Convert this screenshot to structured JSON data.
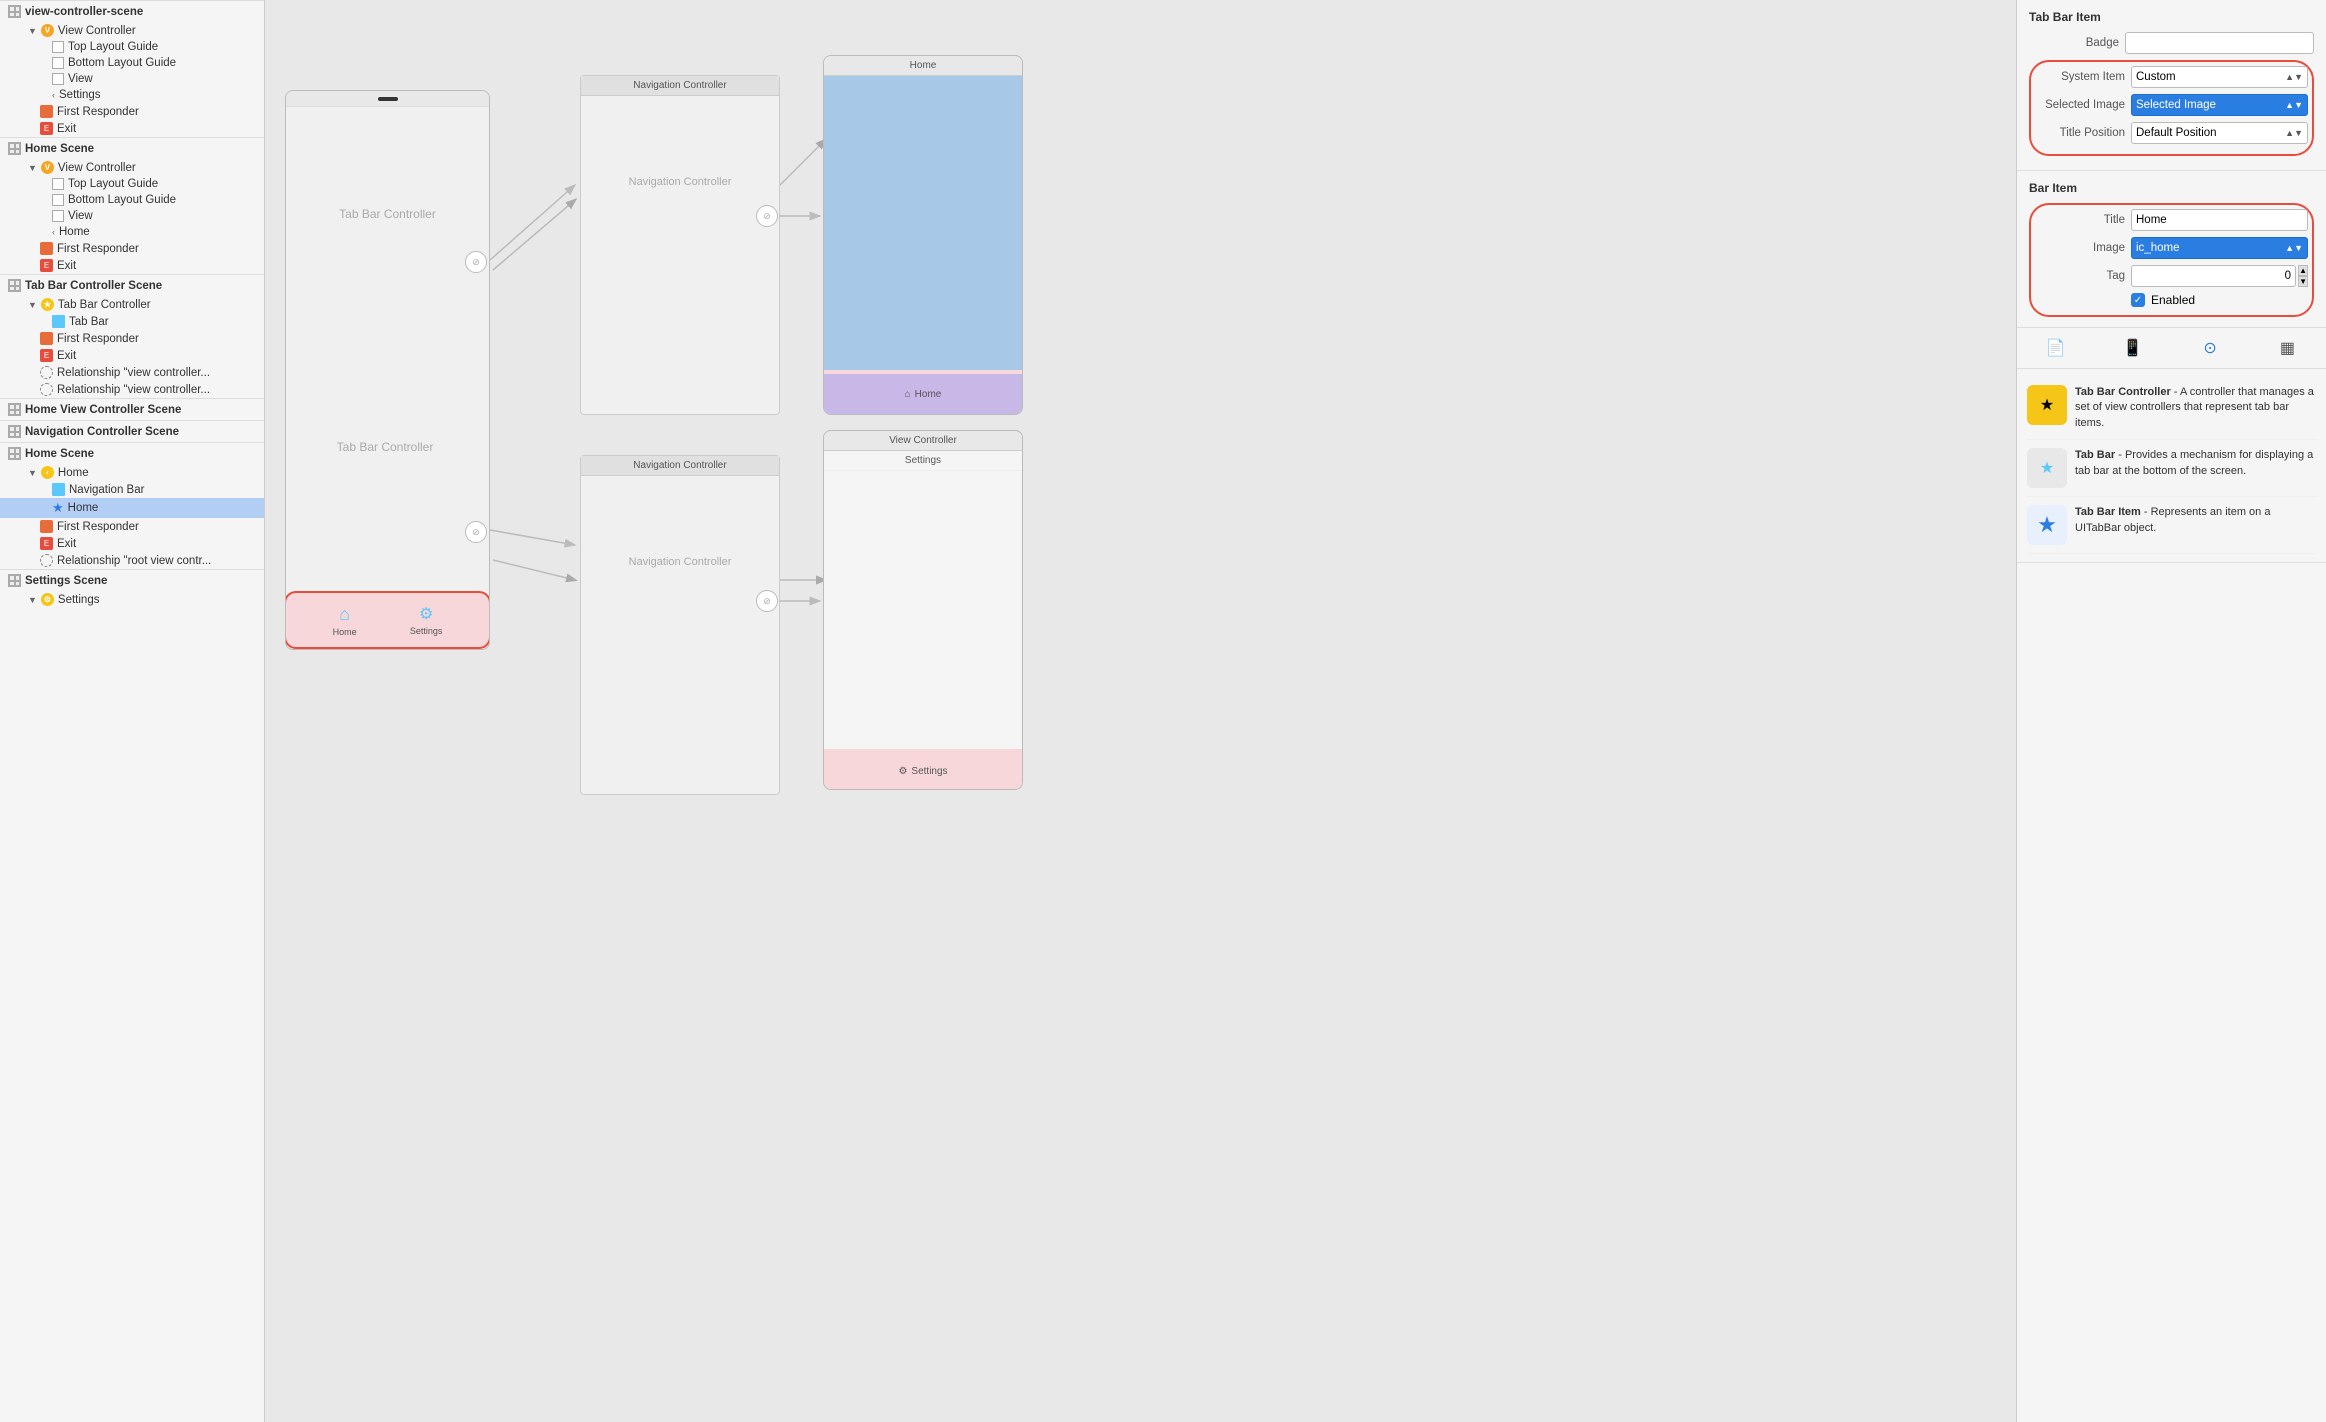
{
  "sidebar": {
    "scenes": [
      {
        "id": "view-controller-scene",
        "label": "View Controller Scene",
        "items": [
          {
            "label": "View Controller",
            "type": "orange-circle",
            "indent": 1,
            "chevron": true
          },
          {
            "label": "Top Layout Guide",
            "type": "white-rect",
            "indent": 3
          },
          {
            "label": "Bottom Layout Guide",
            "type": "white-rect",
            "indent": 3
          },
          {
            "label": "View",
            "type": "white-rect",
            "indent": 3
          },
          {
            "label": "Settings",
            "type": "chevron-left",
            "indent": 3
          },
          {
            "label": "First Responder",
            "type": "responder",
            "indent": 2
          },
          {
            "label": "Exit",
            "type": "red",
            "indent": 2
          }
        ]
      },
      {
        "id": "home-scene",
        "label": "Home Scene",
        "items": [
          {
            "label": "View Controller",
            "type": "orange-circle",
            "indent": 1,
            "chevron": true
          },
          {
            "label": "Top Layout Guide",
            "type": "white-rect",
            "indent": 3
          },
          {
            "label": "Bottom Layout Guide",
            "type": "white-rect",
            "indent": 3
          },
          {
            "label": "View",
            "type": "white-rect",
            "indent": 3
          },
          {
            "label": "Home",
            "type": "chevron-left",
            "indent": 3
          },
          {
            "label": "First Responder",
            "type": "responder",
            "indent": 2
          },
          {
            "label": "Exit",
            "type": "red",
            "indent": 2
          }
        ]
      },
      {
        "id": "tab-bar-controller-scene",
        "label": "Tab Bar Controller Scene",
        "items": [
          {
            "label": "Tab Bar Controller",
            "type": "yellow-circle",
            "indent": 1,
            "chevron": true
          },
          {
            "label": "Tab Bar",
            "type": "tab-bar",
            "indent": 3
          },
          {
            "label": "First Responder",
            "type": "responder",
            "indent": 2
          },
          {
            "label": "Exit",
            "type": "red",
            "indent": 2
          },
          {
            "label": "Relationship \"view controller...",
            "type": "circle-dashed",
            "indent": 2
          },
          {
            "label": "Relationship \"view controller...",
            "type": "circle-dashed",
            "indent": 2
          }
        ]
      },
      {
        "id": "home-view-controller-scene",
        "label": "Home View Controller Scene",
        "items": []
      },
      {
        "id": "navigation-controller-scene",
        "label": "Navigation Controller Scene",
        "items": []
      },
      {
        "id": "home-scene-2",
        "label": "Home Scene",
        "items": [
          {
            "label": "Home",
            "type": "yellow-circle",
            "indent": 1,
            "chevron": true
          },
          {
            "label": "Navigation Bar",
            "type": "nav-bar",
            "indent": 3
          },
          {
            "label": "Home",
            "type": "star",
            "indent": 3,
            "selected": true
          },
          {
            "label": "First Responder",
            "type": "responder",
            "indent": 2
          },
          {
            "label": "Exit",
            "type": "red",
            "indent": 2
          },
          {
            "label": "Relationship \"root view contr...",
            "type": "circle-dashed",
            "indent": 2
          }
        ]
      },
      {
        "id": "settings-scene",
        "label": "Settings Scene",
        "items": [
          {
            "label": "Settings",
            "type": "yellow-circle",
            "indent": 1
          }
        ]
      }
    ]
  },
  "canvas": {
    "tbc_label": "Tab Bar Controller",
    "nav_ctrl_label": "Navigation Controller",
    "nav_ctrl_label2": "Navigation Controller",
    "home_title": "Home",
    "settings_title": "Settings",
    "settings_title2": "Settings",
    "vc_title": "View Controller",
    "tab_home_label": "Home",
    "tab_settings_label": "Settings"
  },
  "right_panel": {
    "tab_bar_item_section": "Tab Bar Item",
    "badge_label": "Badge",
    "system_item_label": "System Item",
    "system_item_value": "Custom",
    "selected_image_label": "Selected Image",
    "selected_image_placeholder": "Selected Image",
    "title_position_label": "Title Position",
    "title_position_value": "Default Position",
    "bar_item_section": "Bar Item",
    "title_label": "Title",
    "title_value": "Home",
    "image_label": "Image",
    "image_value": "ic_home",
    "tag_label": "Tag",
    "tag_value": "0",
    "enabled_label": "Enabled",
    "icon_tabs": [
      "doc",
      "phone",
      "circle",
      "table"
    ],
    "info_items": [
      {
        "title": "Tab Bar Controller",
        "desc": "A controller that manages a set of view controllers that represent tab bar items."
      },
      {
        "title": "Tab Bar",
        "desc": "Provides a mechanism for displaying a tab bar at the bottom of the screen."
      },
      {
        "title": "Tab Bar Item",
        "desc": "Represents an item on a UITabBar object."
      }
    ]
  }
}
